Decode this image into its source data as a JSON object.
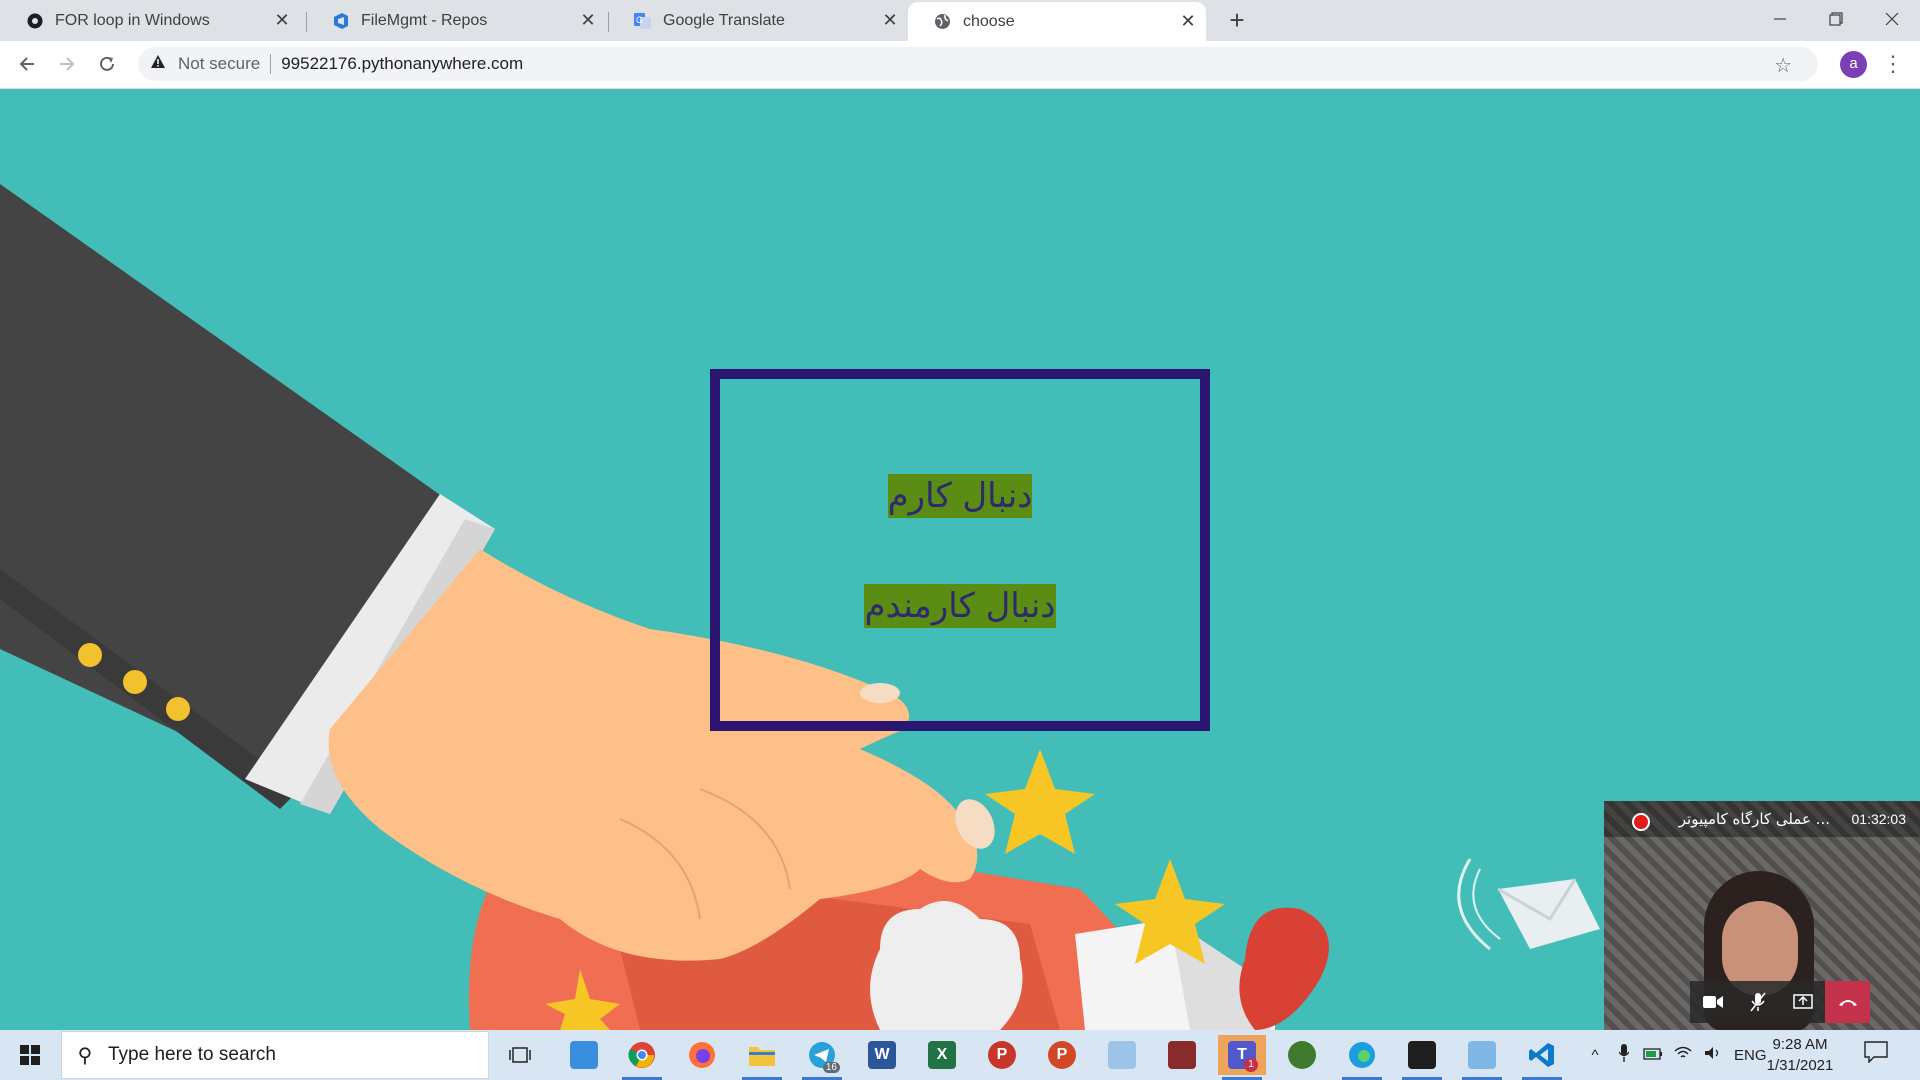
{
  "browser": {
    "tabs": [
      {
        "title": "FOR loop in Windows",
        "icon": "github-icon",
        "active": false
      },
      {
        "title": "FileMgmt - Repos",
        "icon": "azure-devops-icon",
        "active": false
      },
      {
        "title": "Google Translate",
        "icon": "google-translate-icon",
        "active": false
      },
      {
        "title": "choose",
        "icon": "globe-icon",
        "active": true
      }
    ],
    "new_tab_label": "+",
    "security_label": "Not secure",
    "url": "99522176.pythonanywhere.com",
    "profile_initial": "a"
  },
  "page": {
    "options": [
      {
        "label": "دنبال کارم"
      },
      {
        "label": "دنبال کارمندم"
      }
    ],
    "colors": {
      "background": "#42bdb7",
      "box_border": "#2a1670",
      "option_highlight": "#5b8c14",
      "option_text": "#2d2a6e"
    }
  },
  "meeting": {
    "title": "... عملی کارگاه کامپیوتر",
    "elapsed": "01:32:03"
  },
  "taskbar": {
    "search_placeholder": "Type here to search",
    "language": "ENG",
    "time": "9:28 AM",
    "date": "1/31/2021",
    "telegram_badge": "16",
    "teams_badge": "1"
  }
}
